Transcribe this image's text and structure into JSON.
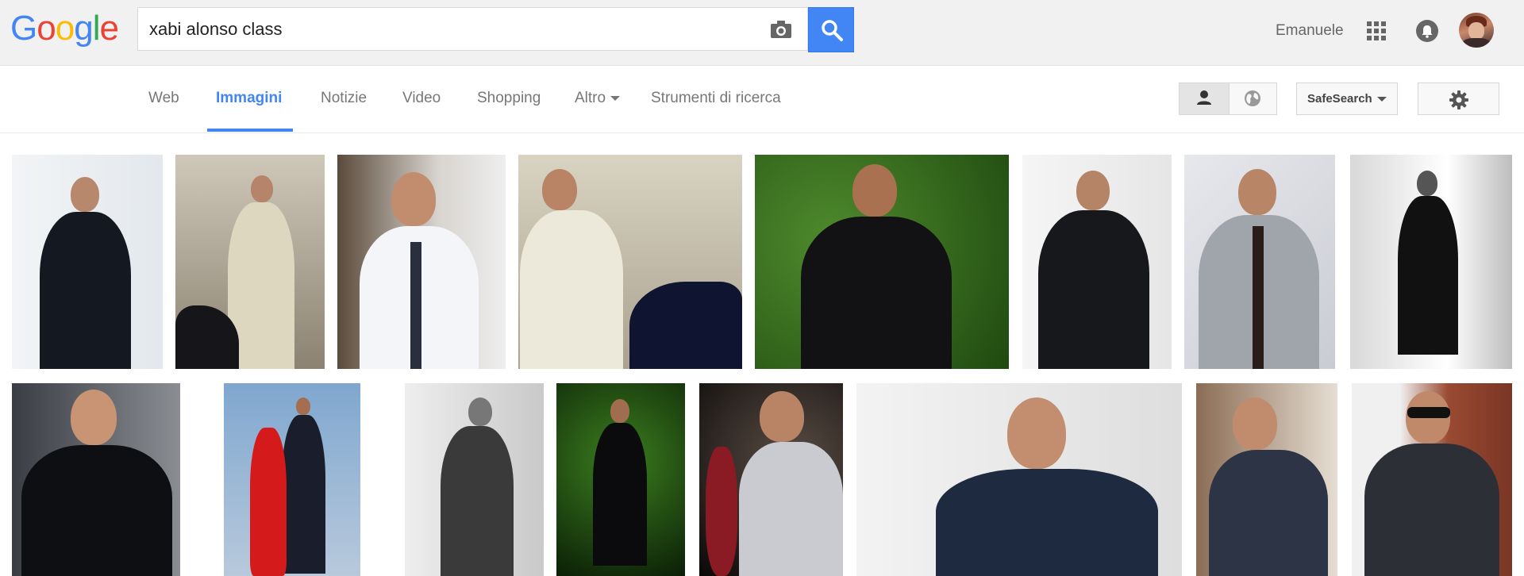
{
  "header": {
    "logo": [
      "G",
      "o",
      "o",
      "g",
      "l",
      "e"
    ],
    "logo_colors": [
      "#4285f4",
      "#ea4335",
      "#fbbc05",
      "#4285f4",
      "#34a853",
      "#ea4335"
    ],
    "search_value": "xabi alonso class",
    "user_name": "Emanuele"
  },
  "nav": {
    "tabs": [
      {
        "label": "Web"
      },
      {
        "label": "Immagini"
      },
      {
        "label": "Notizie"
      },
      {
        "label": "Video"
      },
      {
        "label": "Shopping"
      },
      {
        "label": "Altro"
      },
      {
        "label": "Strumenti di ricerca"
      }
    ],
    "active_tab": "Immagini",
    "safesearch_label": "SafeSearch"
  },
  "icons": {
    "camera": "camera-icon",
    "search": "search-icon",
    "apps": "apps-grid-icon",
    "notifications": "bell-icon",
    "person": "person-icon",
    "globe": "globe-icon",
    "settings": "gear-icon"
  },
  "colors": {
    "accent": "#4285f4",
    "topbar_bg": "#f1f1f1",
    "tab_text": "#777777"
  },
  "results": {
    "row1_count": 8,
    "row2_count": 8
  }
}
